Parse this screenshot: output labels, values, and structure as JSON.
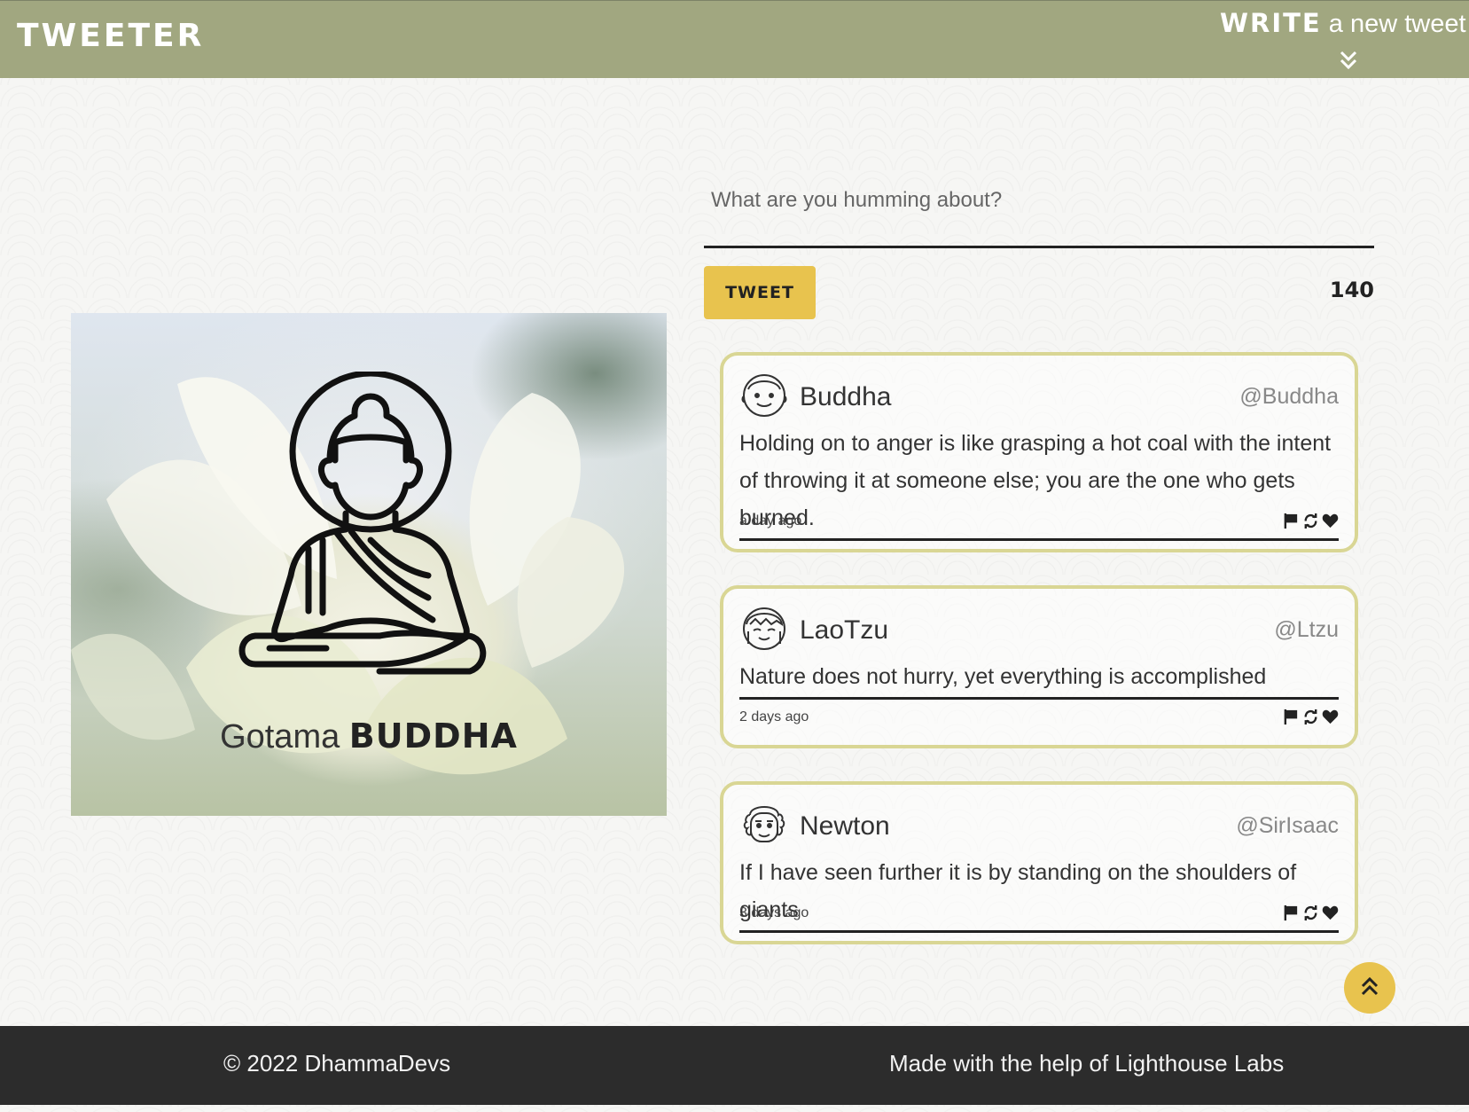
{
  "nav": {
    "brand": "TWEETER",
    "compose_strong": "WRITE",
    "compose_rest": " a new tweet",
    "toggle_icon": "double-chevron-down-icon"
  },
  "hero": {
    "caption_light": "Gotama ",
    "caption_bold": "BUDDHA"
  },
  "compose": {
    "placeholder": "What are you humming about?",
    "button_label": "TWEET",
    "counter": "140"
  },
  "tweets": [
    {
      "name": "Buddha",
      "handle": "@Buddha",
      "text": "Holding on to anger is like grasping a hot coal with the intent of throwing it at someone else; you are the one who gets burned.",
      "time": "a day ago",
      "avatar": "smiling-face-avatar-icon"
    },
    {
      "name": "LaoTzu",
      "handle": "@Ltzu",
      "text": "Nature does not hurry, yet everything is accomplished",
      "time": "2 days ago",
      "avatar": "content-face-avatar-icon"
    },
    {
      "name": "Newton",
      "handle": "@SirIsaac",
      "text": "If I have seen further it is by standing on the shoulders of giants",
      "time": "3 days ago",
      "avatar": "curly-hair-face-avatar-icon"
    }
  ],
  "action_icons": [
    "flag-icon",
    "retweet-icon",
    "heart-icon"
  ],
  "footer": {
    "copyright": "© 2022 DhammaDevs",
    "credit": "Made with the help of Lighthouse Labs"
  },
  "colors": {
    "nav_bg": "#a1a780",
    "accent": "#e8c34e",
    "tweet_border": "#d9d694",
    "footer_bg": "#2c2c2c"
  }
}
